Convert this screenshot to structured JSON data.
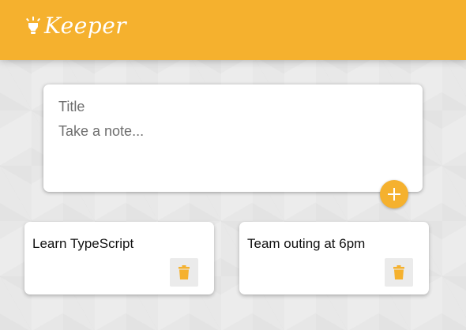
{
  "app": {
    "title": "Keeper",
    "brand_color": "#f5b12e",
    "logo_icon": "lightbulb-icon"
  },
  "create_note": {
    "title_placeholder": "Title",
    "content_placeholder": "Take a note...",
    "add_icon": "plus-icon"
  },
  "notes": [
    {
      "title": "Learn TypeScript",
      "delete_icon": "trash-icon"
    },
    {
      "title": "Team outing at 6pm",
      "delete_icon": "trash-icon"
    }
  ]
}
